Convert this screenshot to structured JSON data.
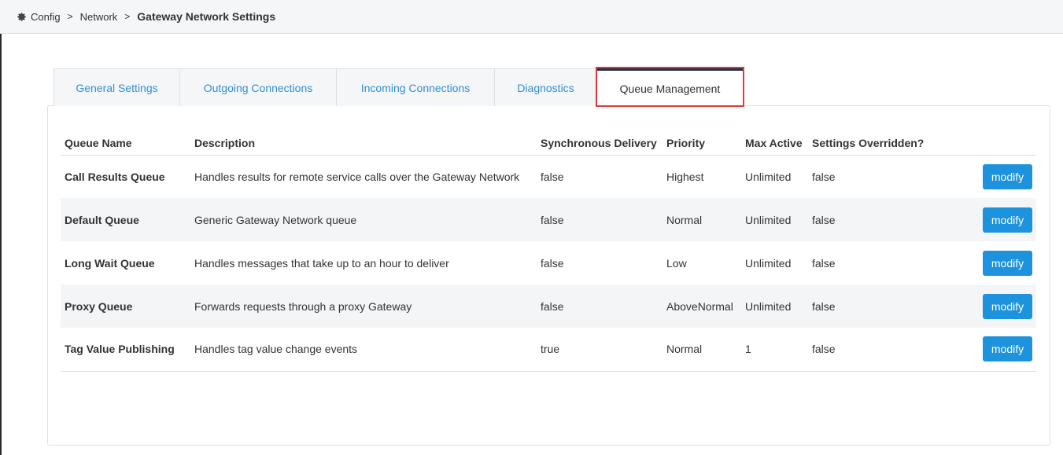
{
  "breadcrumb": {
    "icon": "gear-icon",
    "items": [
      "Config",
      "Network"
    ],
    "current": "Gateway Network Settings",
    "separator": ">"
  },
  "tabs": [
    {
      "label": "General Settings",
      "active": false
    },
    {
      "label": "Outgoing Connections",
      "active": false
    },
    {
      "label": "Incoming Connections",
      "active": false
    },
    {
      "label": "Diagnostics",
      "active": false
    },
    {
      "label": "Queue Management",
      "active": true
    }
  ],
  "table": {
    "headers": [
      "Queue Name",
      "Description",
      "Synchronous Delivery",
      "Priority",
      "Max Active",
      "Settings Overridden?"
    ],
    "rows": [
      {
        "name": "Call Results Queue",
        "description": "Handles results for remote service calls over the Gateway Network",
        "sync": "false",
        "priority": "Highest",
        "max_active": "Unlimited",
        "overridden": "false",
        "action": "modify"
      },
      {
        "name": "Default Queue",
        "description": "Generic Gateway Network queue",
        "sync": "false",
        "priority": "Normal",
        "max_active": "Unlimited",
        "overridden": "false",
        "action": "modify"
      },
      {
        "name": "Long Wait Queue",
        "description": "Handles messages that take up to an hour to deliver",
        "sync": "false",
        "priority": "Low",
        "max_active": "Unlimited",
        "overridden": "false",
        "action": "modify"
      },
      {
        "name": "Proxy Queue",
        "description": "Forwards requests through a proxy Gateway",
        "sync": "false",
        "priority": "AboveNormal",
        "max_active": "Unlimited",
        "overridden": "false",
        "action": "modify"
      },
      {
        "name": "Tag Value Publishing",
        "description": "Handles tag value change events",
        "sync": "true",
        "priority": "Normal",
        "max_active": "1",
        "overridden": "false",
        "action": "modify"
      }
    ]
  },
  "colors": {
    "link": "#2f8fd6",
    "button": "#1d92dd",
    "highlight": "#e03a3a",
    "active_tab_top": "#1d3149"
  }
}
